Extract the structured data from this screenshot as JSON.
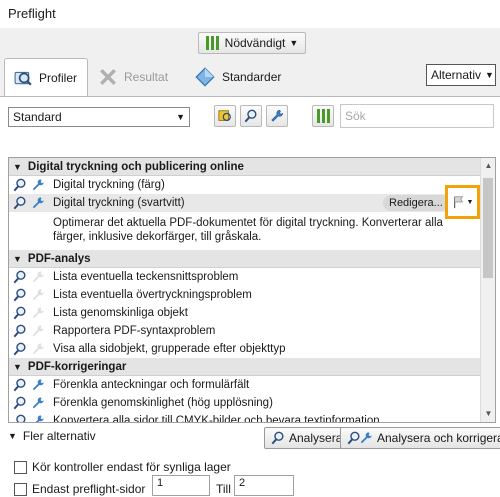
{
  "window": {
    "title": "Preflight"
  },
  "top": {
    "severity_label": "Nödvändigt"
  },
  "tabs": [
    {
      "label": "Profiler"
    },
    {
      "label": "Resultat"
    },
    {
      "label": "Standarder"
    }
  ],
  "options_menu": {
    "label": "Alternativ"
  },
  "profile_select": {
    "value": "Standard"
  },
  "search": {
    "placeholder": "Sök"
  },
  "list": {
    "groups": [
      {
        "title": "Digital tryckning och publicering online",
        "items": [
          "Digital tryckning (färg)",
          "Digital tryckning (svartvitt)"
        ]
      },
      {
        "title": "PDF-analys",
        "items": [
          "Lista eventuella teckensnittsproblem",
          "Lista eventuella övertryckningsproblem",
          "Lista genomskinliga objekt",
          "Rapportera PDF-syntaxproblem",
          "Visa alla sidobjekt, grupperade efter objekttyp"
        ]
      },
      {
        "title": "PDF-korrigeringar",
        "items": [
          "Förenkla anteckningar och formulärfält",
          "Förenkla genomskinlighet (hög upplösning)",
          "Konvertera alla sidor till CMYK-bilder och bevara textinformation"
        ]
      }
    ],
    "edit_label": "Redigera...",
    "description": "Optimerar det aktuella PDF-dokumentet för digital tryckning. Konverterar alla färger, inklusive dekorfärger, till gråskala."
  },
  "more_options": {
    "label": "Fler alternativ"
  },
  "actions": {
    "analyze": "Analysera",
    "analyze_fix": "Analysera och korrigera"
  },
  "filters": {
    "visible_layers": "Kör kontroller endast för synliga lager",
    "preflight_pages": "Endast preflight-sidor",
    "from": "1",
    "to_label": "Till",
    "to": "2"
  },
  "colors": {
    "accent_highlight": "#f0a30a",
    "bars_green": "#4a9a2a"
  },
  "icons": {
    "magnifier": "magnifier-icon",
    "wrench": "wrench-icon",
    "flag": "flag-icon",
    "bars": "bars-icon",
    "profiles": "profiles-icon",
    "results": "results-icon",
    "standards": "standards-icon"
  }
}
